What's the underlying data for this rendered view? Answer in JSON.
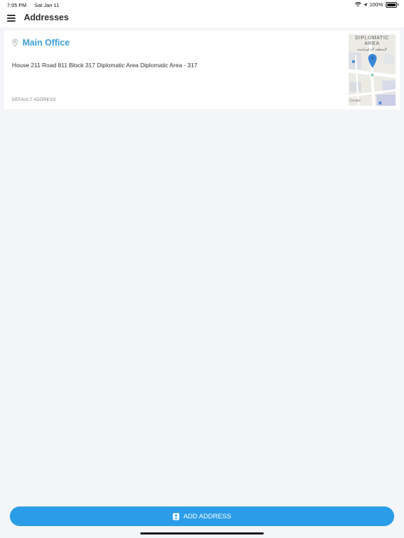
{
  "status_bar": {
    "time": "7:05 PM",
    "date": "Sat Jan 11",
    "battery": "100%"
  },
  "header": {
    "title": "Addresses"
  },
  "addresses": [
    {
      "name": "Main Office",
      "address": "House 211  Road 811 Block 317 Diplomatic Area Diplomatic Area - 317",
      "label": "DEFAULT ADDRESS",
      "map": {
        "area_label_line1": "DIPLOMATIC",
        "area_label_line2": "AREA",
        "area_label_arabic": "المنطقة الدبلوماسية"
      }
    }
  ],
  "footer": {
    "add_button_label": "ADD ADDRESS"
  },
  "colors": {
    "accent": "#2b9de8",
    "title_blue": "#3c9ed9",
    "background": "#f3f5f8"
  }
}
